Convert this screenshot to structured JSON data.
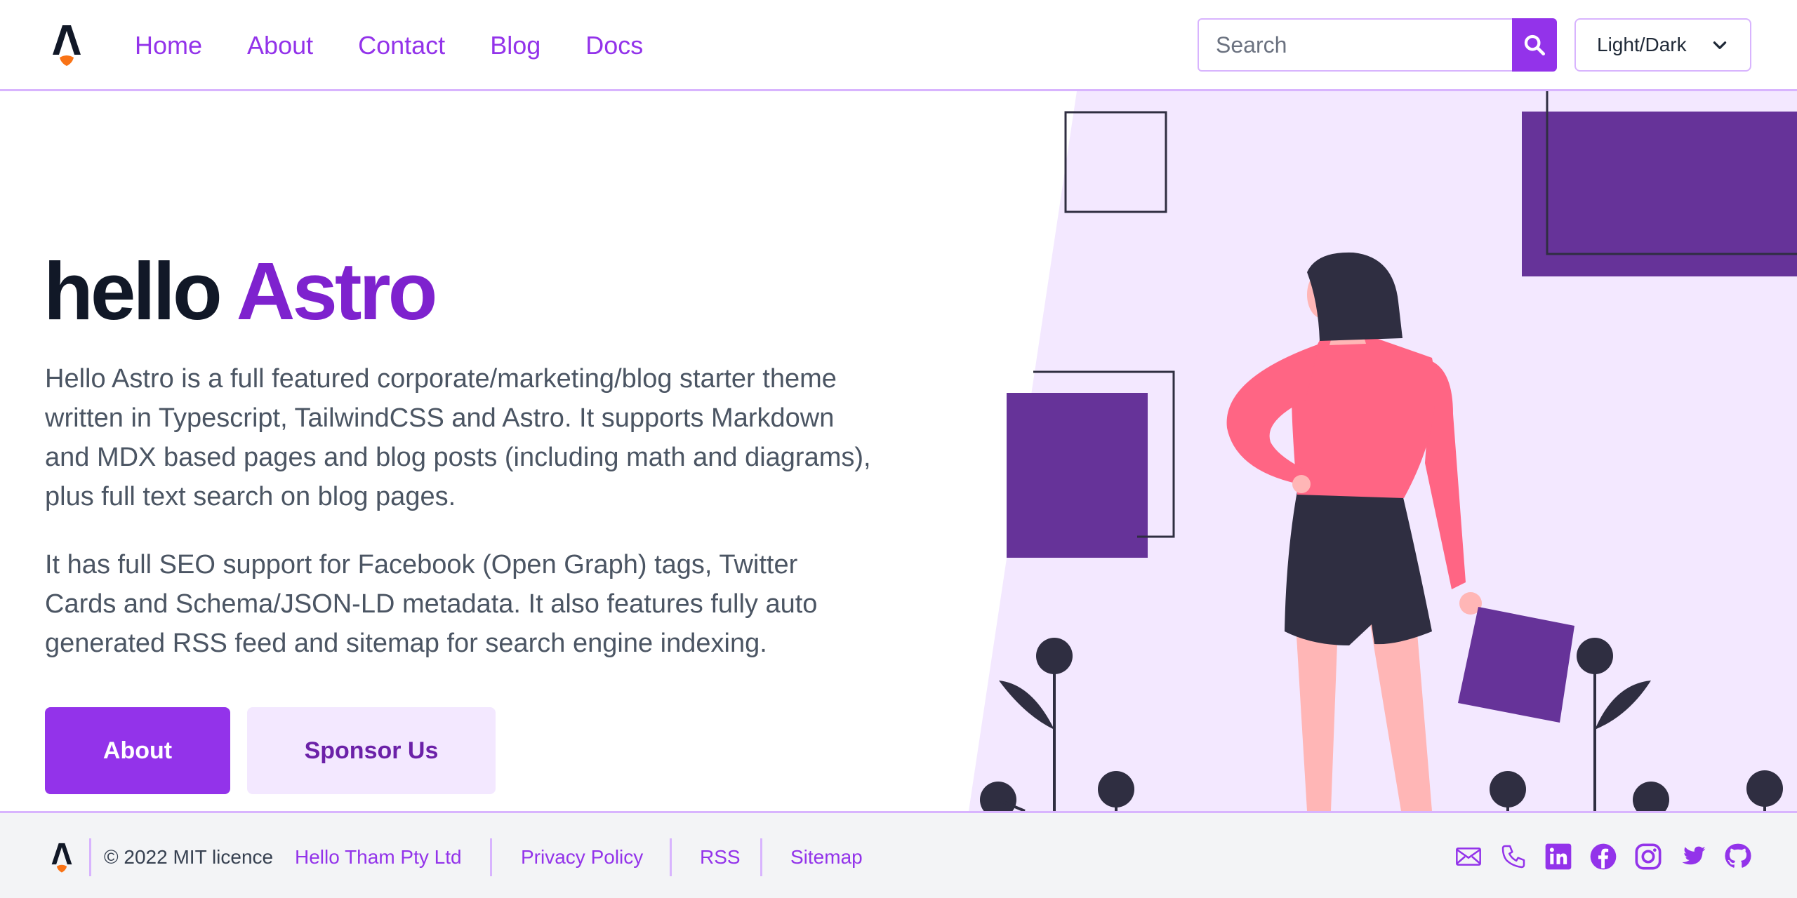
{
  "header": {
    "nav": [
      "Home",
      "About",
      "Contact",
      "Blog",
      "Docs"
    ],
    "search_placeholder": "Search",
    "theme_select": "Light/Dark"
  },
  "hero": {
    "title_dark": "hello",
    "title_accent": "Astro",
    "paragraph1": "Hello Astro is a full featured corporate/marketing/blog starter theme written in Typescript, TailwindCSS and Astro. It supports Markdown and MDX based pages and blog posts (including math and diagrams), plus full text search on blog pages.",
    "paragraph2": "It has full SEO support for Facebook (Open Graph) tags, Twitter Cards and Schema/JSON-LD metadata. It also features fully auto generated RSS feed and sitemap for search engine indexing.",
    "btn_primary": "About",
    "btn_secondary": "Sponsor Us"
  },
  "footer": {
    "copyright": "© 2022 MIT licence",
    "company": "Hello Tham Pty Ltd",
    "links": [
      "Privacy Policy",
      "RSS",
      "Sitemap"
    ],
    "social_icons": [
      "mail-icon",
      "phone-icon",
      "linkedin-icon",
      "facebook-icon",
      "instagram-icon",
      "twitter-icon",
      "github-icon"
    ]
  },
  "colors": {
    "accent": "#9333ea",
    "accent_dark": "#7e22ce",
    "illustration_purple": "#663399",
    "illustration_bg": "#f3e8ff",
    "figure_top": "#ff6584",
    "figure_dark": "#2f2e41",
    "skin": "#ffb6b6"
  }
}
